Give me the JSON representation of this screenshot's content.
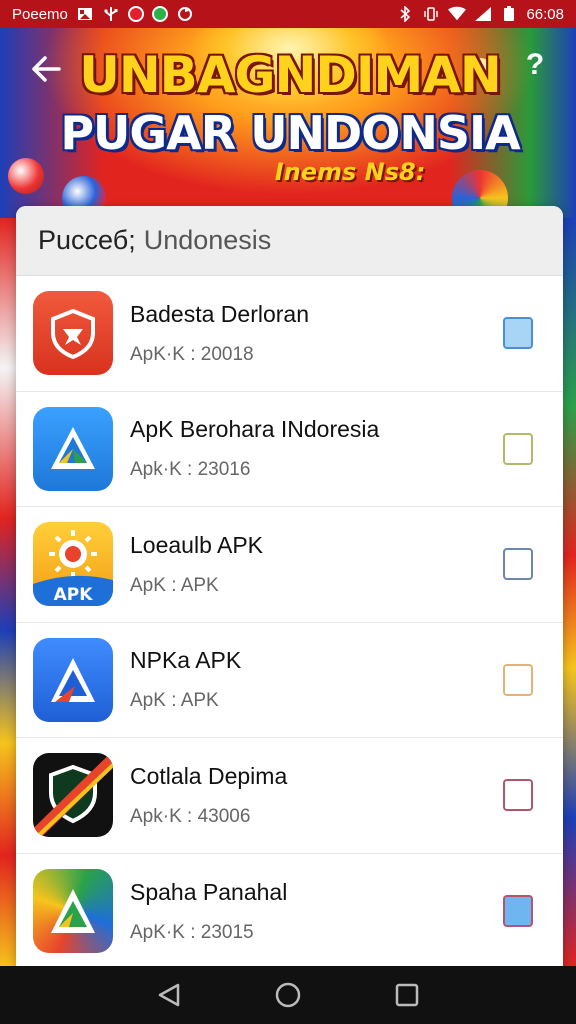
{
  "status_bar": {
    "carrier": "Poeemo",
    "time": "66:08"
  },
  "banner": {
    "title_line1": "UNBAGNDIMAN",
    "title_line2": "PUGAR UNDONSIA",
    "subtitle": "Inems Ns8:"
  },
  "card": {
    "header_main": "Puссеб;",
    "header_muted": "Undonesis"
  },
  "apps": [
    {
      "title": "Badesta Derloran",
      "subtitle": "ApK·K : 20018",
      "icon": "red-shield-icon",
      "icon_color": "#e8442b",
      "checkbox_color": "#4a90d9",
      "checkbox_fill": "#a8d4f5"
    },
    {
      "title": "ApK Berohara INdoresia",
      "subtitle": "Apk·K : 23016",
      "icon": "blue-triangle-icon",
      "icon_color": "#2b8fe8",
      "checkbox_color": "#b4b86a",
      "checkbox_fill": "#ffffff"
    },
    {
      "title": "Loeaulb APK",
      "subtitle": "ApK : APK",
      "icon": "sun-apk-icon",
      "icon_color": "#f6b21d",
      "checkbox_color": "#6e86ac",
      "checkbox_fill": "#ffffff"
    },
    {
      "title": "NPKa APK",
      "subtitle": "ApK : APK",
      "icon": "blue-arrow-icon",
      "icon_color": "#2a6fe0",
      "checkbox_color": "#e3b27a",
      "checkbox_fill": "#ffffff"
    },
    {
      "title": "Cotlala Depima",
      "subtitle": "Apk·K : 43006",
      "icon": "black-shield-icon",
      "icon_color": "#111111",
      "checkbox_color": "#b2566e",
      "checkbox_fill": "#ffffff"
    },
    {
      "title": "Spaha Panahal",
      "subtitle": "ApK·K : 23015",
      "icon": "rainbow-triangle-icon",
      "icon_color": "#d93b2a",
      "checkbox_color": "#b2566e",
      "checkbox_fill": "#6fb5f0"
    }
  ],
  "nav": {
    "back": "back-triangle-icon",
    "home": "home-circle-icon",
    "recents": "recents-square-icon"
  }
}
